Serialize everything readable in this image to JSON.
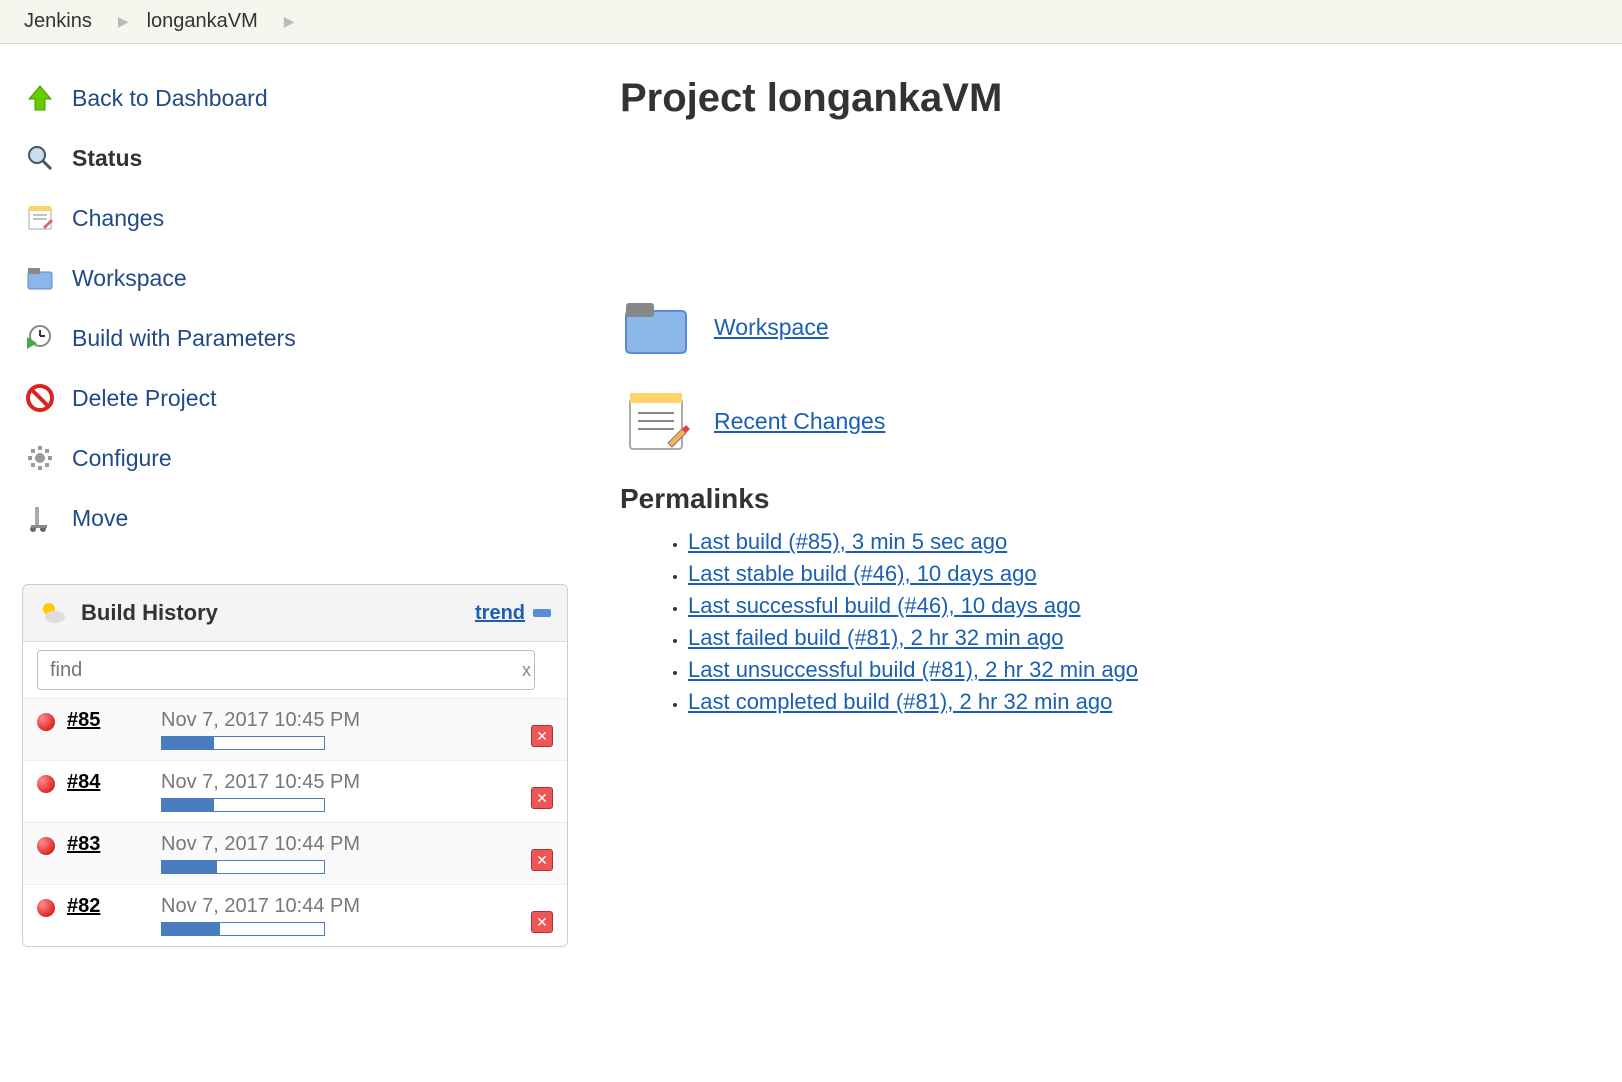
{
  "breadcrumb": {
    "root": "Jenkins",
    "project": "longankaVM"
  },
  "sidebar": {
    "items": [
      {
        "label": "Back to Dashboard",
        "name": "back-to-dashboard",
        "icon": "up-arrow-icon"
      },
      {
        "label": "Status",
        "name": "status",
        "icon": "magnifier-icon",
        "active": true
      },
      {
        "label": "Changes",
        "name": "changes",
        "icon": "notepad-icon"
      },
      {
        "label": "Workspace",
        "name": "workspace",
        "icon": "folder-icon"
      },
      {
        "label": "Build with Parameters",
        "name": "build-with-parameters",
        "icon": "clock-play-icon"
      },
      {
        "label": "Delete Project",
        "name": "delete-project",
        "icon": "no-entry-icon"
      },
      {
        "label": "Configure",
        "name": "configure",
        "icon": "gear-icon"
      },
      {
        "label": "Move",
        "name": "move",
        "icon": "dolly-icon"
      }
    ]
  },
  "build_history": {
    "title": "Build History",
    "trend_label": "trend",
    "find_placeholder": "find",
    "builds": [
      {
        "id": "#85",
        "time": "Nov 7, 2017 10:45 PM",
        "progress": 32
      },
      {
        "id": "#84",
        "time": "Nov 7, 2017 10:45 PM",
        "progress": 32
      },
      {
        "id": "#83",
        "time": "Nov 7, 2017 10:44 PM",
        "progress": 34
      },
      {
        "id": "#82",
        "time": "Nov 7, 2017 10:44 PM",
        "progress": 36
      }
    ]
  },
  "main": {
    "title": "Project longankaVM",
    "workspace_label": "Workspace",
    "recent_changes_label": "Recent Changes",
    "permalinks_title": "Permalinks",
    "permalinks": [
      "Last build (#85), 3 min 5 sec ago",
      "Last stable build (#46), 10 days ago",
      "Last successful build (#46), 10 days ago",
      "Last failed build (#81), 2 hr 32 min ago",
      "Last unsuccessful build (#81), 2 hr 32 min ago",
      "Last completed build (#81), 2 hr 32 min ago"
    ]
  }
}
